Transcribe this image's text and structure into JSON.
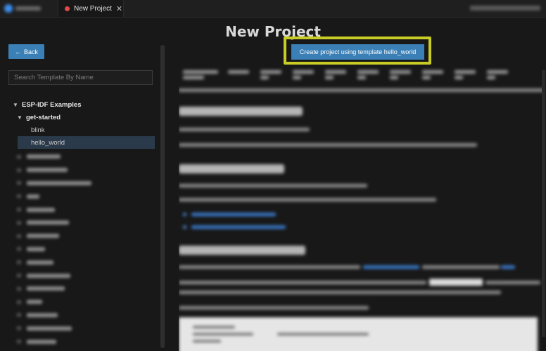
{
  "window": {
    "tab_title": "New Project",
    "tab_close_glyph": "✕",
    "tab_icon": "record-dot-icon"
  },
  "page": {
    "title": "New Project"
  },
  "sidebar": {
    "back_label": "Back",
    "back_icon": "arrow-left-icon",
    "search_placeholder": "Search Template By Name",
    "tree": {
      "root_label": "ESP-IDF Examples",
      "group_label": "get-started",
      "items": [
        {
          "label": "blink",
          "selected": false
        },
        {
          "label": "hello_world",
          "selected": true
        }
      ]
    }
  },
  "main": {
    "create_button_label": "Create project using template hello_world",
    "highlight_color": "#c8cc25"
  },
  "colors": {
    "accent": "#3a7fb5",
    "background": "#181818"
  }
}
